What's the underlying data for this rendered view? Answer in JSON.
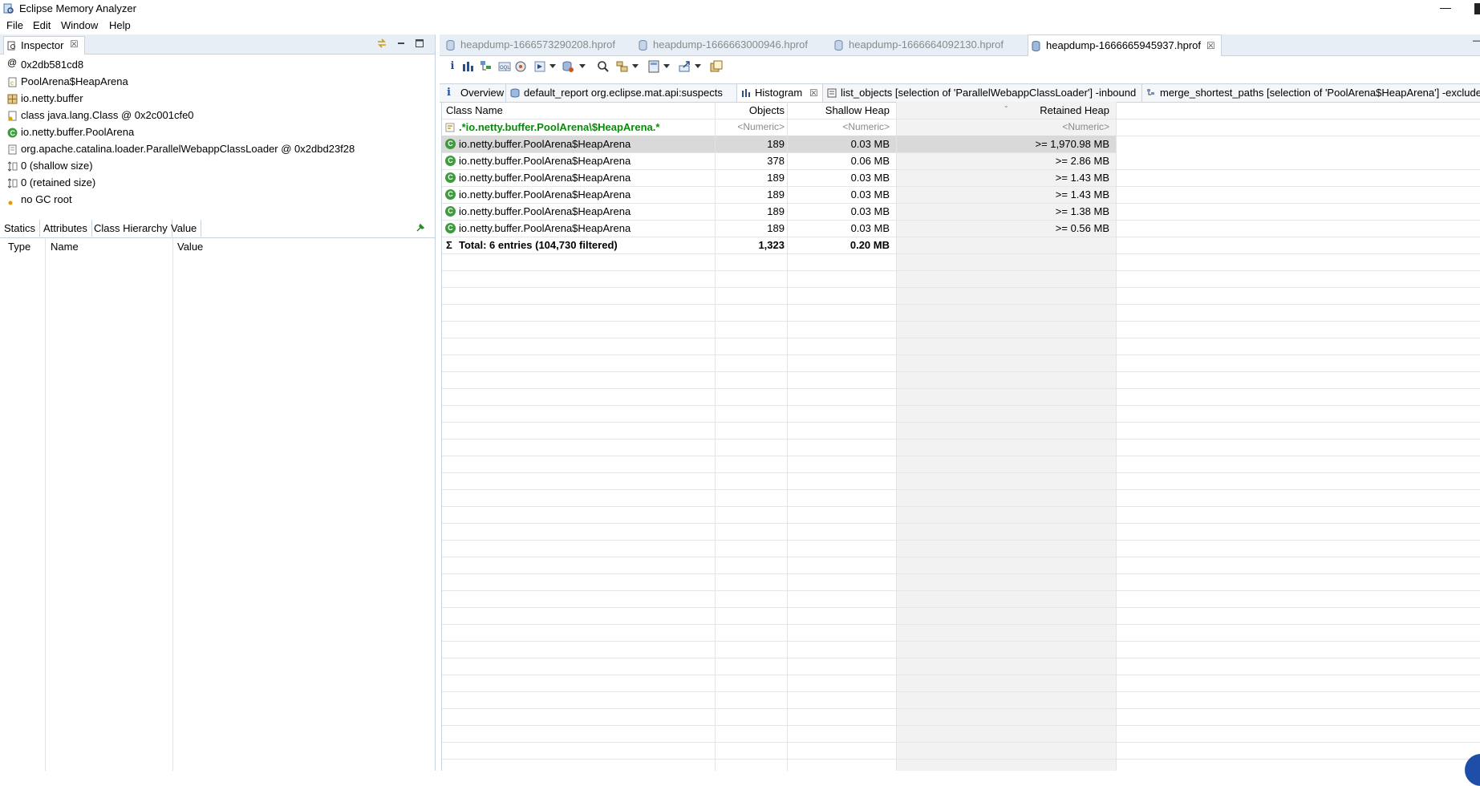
{
  "window": {
    "title": "Eclipse Memory Analyzer",
    "minimize_symbol": "—"
  },
  "menu": [
    "File",
    "Edit",
    "Window",
    "Help"
  ],
  "inspector": {
    "tab_label": "Inspector",
    "close_symbol": "☒",
    "rows": [
      {
        "icon": "at-icon",
        "text": "0x2db581cd8"
      },
      {
        "icon": "class-file-icon",
        "text": "PoolArena$HeapArena"
      },
      {
        "icon": "package-icon",
        "text": "io.netty.buffer"
      },
      {
        "icon": "class-object-icon",
        "text": "class java.lang.Class @ 0x2c001cfe0"
      },
      {
        "icon": "class-green-icon",
        "text": "io.netty.buffer.PoolArena"
      },
      {
        "icon": "classloader-icon",
        "text": "org.apache.catalina.loader.ParallelWebappClassLoader @ 0x2dbd23f28"
      },
      {
        "icon": "size-icon",
        "text": "0 (shallow size)"
      },
      {
        "icon": "size-icon",
        "text": "0 (retained size)"
      },
      {
        "icon": "gc-root-icon",
        "text": "no GC root"
      }
    ],
    "subtabs": [
      "Statics",
      "Attributes",
      "Class Hierarchy",
      "Value"
    ],
    "columns": [
      "Type",
      "Name",
      "Value"
    ]
  },
  "editor": {
    "file_tabs": [
      {
        "label": "heapdump-1666573290208.hprof",
        "active": false
      },
      {
        "label": "heapdump-1666663000946.hprof",
        "active": false
      },
      {
        "label": "heapdump-1666664092130.hprof",
        "active": false
      },
      {
        "label": "heapdump-1666665945937.hprof",
        "active": true
      }
    ],
    "query_tabs": [
      {
        "label": "Overview",
        "icon": "info-icon"
      },
      {
        "label": "default_report  org.eclipse.mat.api:suspects",
        "icon": "report-icon"
      },
      {
        "label": "Histogram",
        "icon": "histogram-icon",
        "active": true
      },
      {
        "label": "list_objects [selection of 'ParallelWebappClassLoader'] -inbound",
        "icon": "list-icon"
      },
      {
        "label": "merge_shortest_paths [selection of 'PoolArena$HeapArena'] -exclude",
        "icon": "paths-icon"
      }
    ],
    "table": {
      "headers": [
        "Class Name",
        "Objects",
        "Shallow Heap",
        "Retained Heap"
      ],
      "filter": {
        "class_name": ".*io.netty.buffer.PoolArena\\$HeapArena.*",
        "objects": "<Numeric>",
        "shallow": "<Numeric>",
        "retained": "<Numeric>"
      },
      "rows": [
        {
          "name": "io.netty.buffer.PoolArena$HeapArena",
          "objects": "189",
          "shallow": "0.03 MB",
          "retained": ">= 1,970.98 MB",
          "selected": true
        },
        {
          "name": "io.netty.buffer.PoolArena$HeapArena",
          "objects": "378",
          "shallow": "0.06 MB",
          "retained": ">= 2.86 MB"
        },
        {
          "name": "io.netty.buffer.PoolArena$HeapArena",
          "objects": "189",
          "shallow": "0.03 MB",
          "retained": ">= 1.43 MB"
        },
        {
          "name": "io.netty.buffer.PoolArena$HeapArena",
          "objects": "189",
          "shallow": "0.03 MB",
          "retained": ">= 1.43 MB"
        },
        {
          "name": "io.netty.buffer.PoolArena$HeapArena",
          "objects": "189",
          "shallow": "0.03 MB",
          "retained": ">= 1.38 MB"
        },
        {
          "name": "io.netty.buffer.PoolArena$HeapArena",
          "objects": "189",
          "shallow": "0.03 MB",
          "retained": ">= 0.56 MB"
        }
      ],
      "total": {
        "name": "Total: 6 entries (104,730 filtered)",
        "objects": "1,323",
        "shallow": "0.20 MB",
        "symbol": "Σ"
      }
    }
  },
  "colors": {
    "accent": "#1f4ea8",
    "class_green": "#3f9b3f",
    "filter_green": "#0a8a0a",
    "tab_bg": "#e8eef6"
  }
}
